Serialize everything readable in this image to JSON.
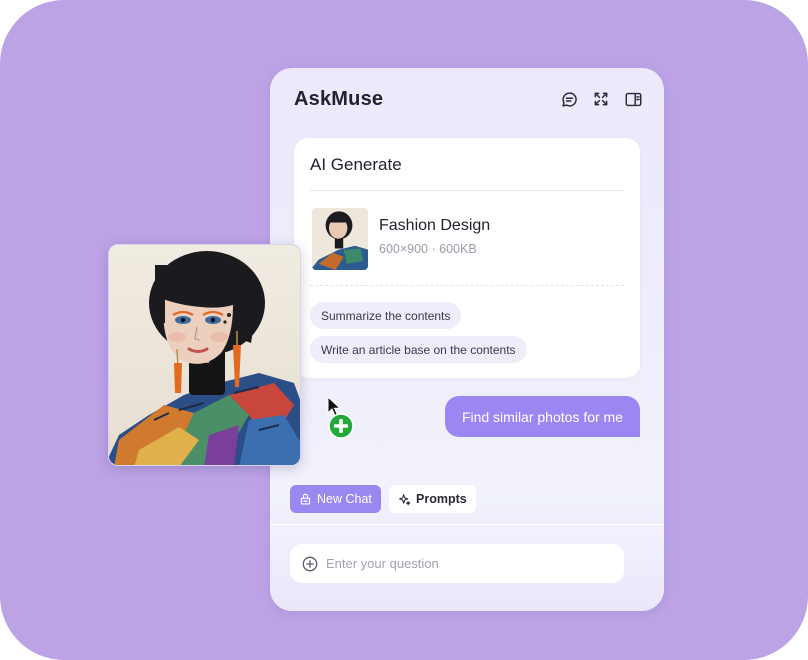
{
  "app": {
    "title": "AskMuse"
  },
  "header_icons": [
    "chat-bubble-icon",
    "expand-icon",
    "sidebar-panel-icon"
  ],
  "card": {
    "title": "AI Generate",
    "file": {
      "name": "Fashion Design",
      "meta": "600×900 · 600KB"
    },
    "suggestions": [
      "Summarize the contents",
      "Write an article base on the contents"
    ]
  },
  "chat": {
    "user_message": "Find similar photos for me"
  },
  "toolbar": {
    "new_chat": "New Chat",
    "prompts": "Prompts"
  },
  "input": {
    "placeholder": "Enter your question"
  },
  "colors": {
    "background": "#bca3e6",
    "accent": "#9c86f2",
    "add_badge": "#22a93a"
  }
}
